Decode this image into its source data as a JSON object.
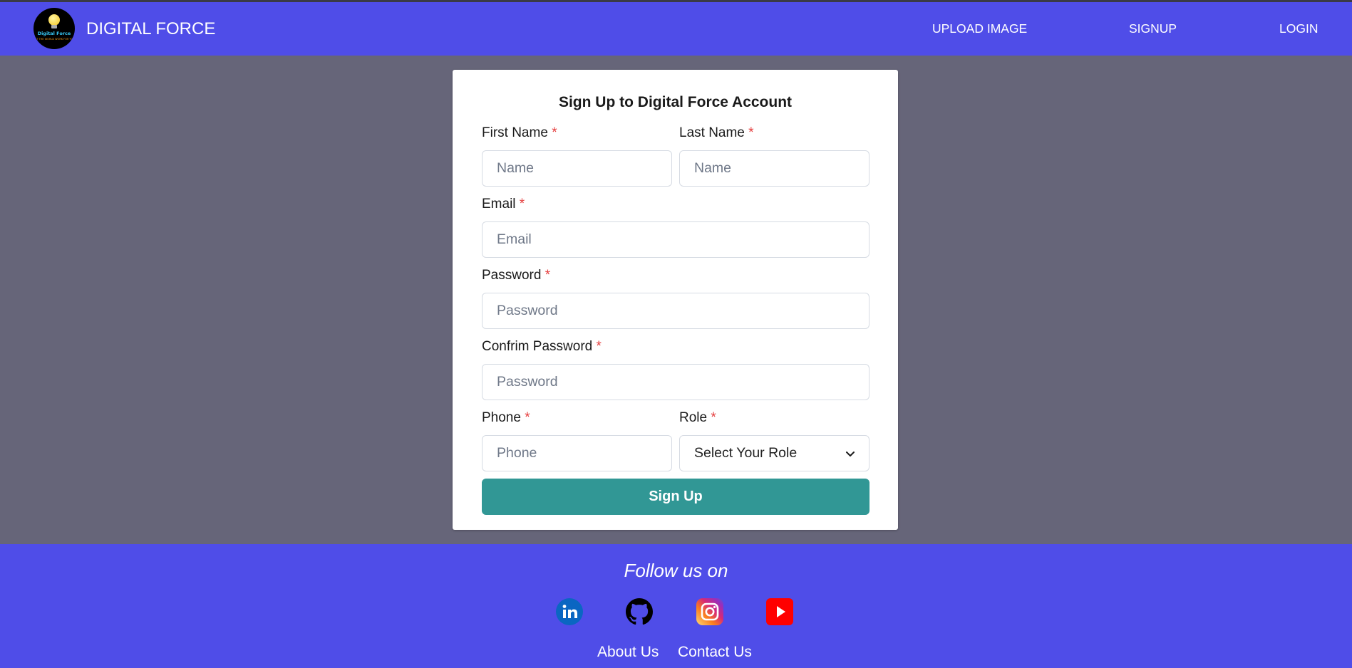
{
  "header": {
    "logo_text": "Digital Force",
    "logo_tagline": "LET THE WORLD WORK FOR YOU",
    "brand": "DIGITAL FORCE",
    "nav": [
      {
        "label": "UPLOAD IMAGE"
      },
      {
        "label": "SIGNUP"
      },
      {
        "label": "LOGIN"
      }
    ]
  },
  "form": {
    "title": "Sign Up to Digital Force Account",
    "required_marker": "*",
    "first_name": {
      "label": "First Name",
      "placeholder": "Name"
    },
    "last_name": {
      "label": "Last Name",
      "placeholder": "Name"
    },
    "email": {
      "label": "Email",
      "placeholder": "Email"
    },
    "password": {
      "label": "Password",
      "placeholder": "Password"
    },
    "confirm_password": {
      "label": "Confrim Password",
      "placeholder": "Password"
    },
    "phone": {
      "label": "Phone",
      "placeholder": "Phone"
    },
    "role": {
      "label": "Role",
      "selected": "Select Your Role"
    },
    "submit_label": "Sign Up"
  },
  "footer": {
    "follow_text": "Follow us on",
    "social": [
      {
        "icon": "linkedin-icon",
        "color": "#0a66c2"
      },
      {
        "icon": "github-icon",
        "color": "#000000"
      },
      {
        "icon": "instagram-icon",
        "color": "#e1306c"
      },
      {
        "icon": "youtube-icon",
        "color": "#ff0000"
      }
    ],
    "links": [
      {
        "label": "About Us"
      },
      {
        "label": "Contact Us"
      }
    ]
  },
  "colors": {
    "primary": "#4f4de8",
    "overlay_background": "#666579",
    "submit_button": "#319795",
    "required": "#e53e3e"
  }
}
